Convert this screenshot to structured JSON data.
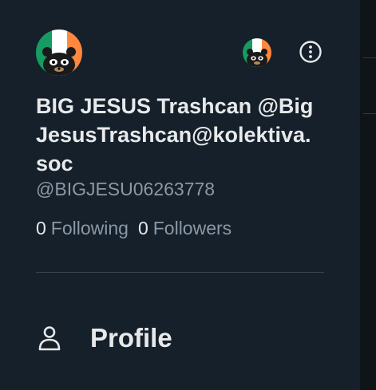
{
  "account": {
    "display_name": "BIG JESUS Trashcan @BigJesusTrashcan@kolektiva.soc",
    "handle": "@BIGJESU06263778"
  },
  "stats": {
    "following_count": "0",
    "following_label": "Following",
    "followers_count": "0",
    "followers_label": "Followers"
  },
  "nav": {
    "profile_label": "Profile",
    "profile_icon": "person-outline-icon"
  },
  "icons": {
    "more": "more-circle-icon",
    "avatar_main": "raccoon-irish-flag-avatar",
    "avatar_secondary": "raccoon-irish-flag-avatar"
  },
  "colors": {
    "background": "#15202b",
    "text_primary": "#e7e9ea",
    "text_secondary": "#8b98a5",
    "divider": "#38444d",
    "flag_green": "#169b62",
    "flag_white": "#ffffff",
    "flag_orange": "#ff883e"
  }
}
